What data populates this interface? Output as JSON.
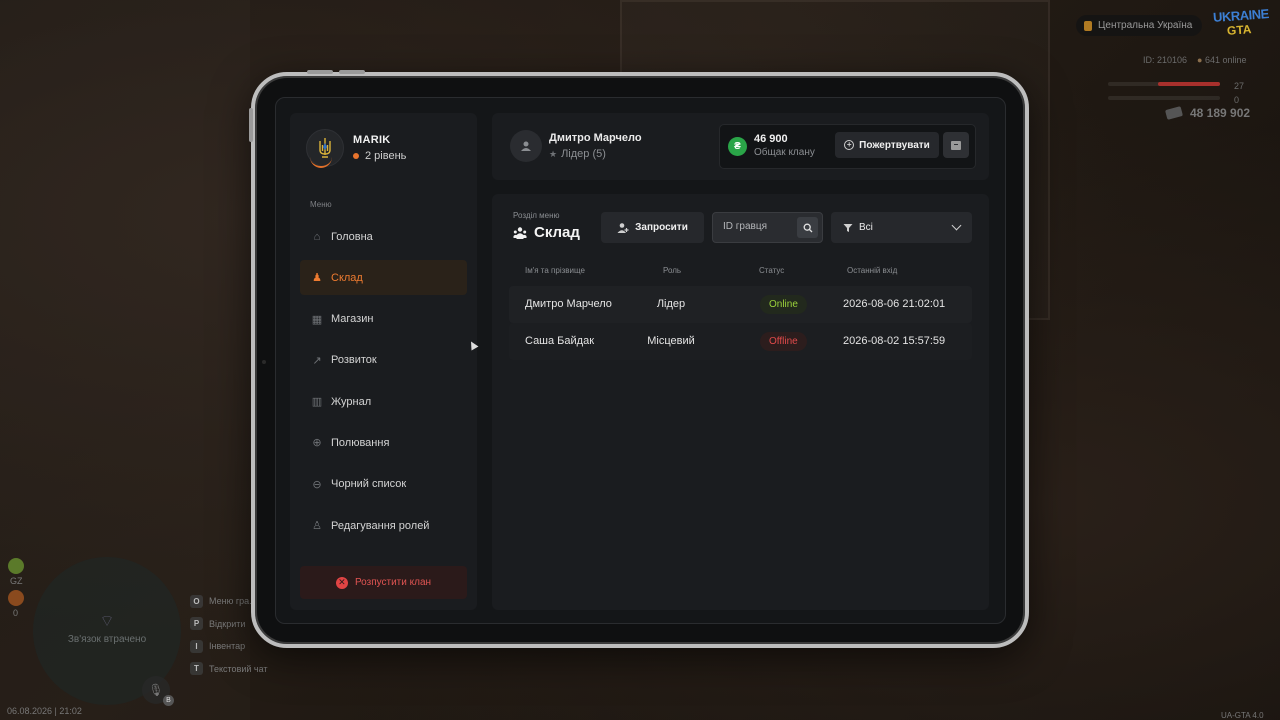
{
  "hud": {
    "region": "Центральна Україна",
    "logo_line1": "UKRAINE",
    "logo_line2": "GTA",
    "player_id": "ID: 210106",
    "online": "641 online",
    "health": "27",
    "armor": "0",
    "health_level": 0.55,
    "armor_level": 0.0,
    "money": "48 189 902",
    "gz_label": "GZ",
    "zero_label": "0",
    "minimap_text": "Зв'язок втрачено",
    "mic_badge": "B",
    "keys": [
      {
        "key": "O",
        "label": "Меню гра..."
      },
      {
        "key": "P",
        "label": "Відкрити"
      },
      {
        "key": "I",
        "label": "Інвентар"
      },
      {
        "key": "T",
        "label": "Текстовий чат"
      }
    ],
    "datetime": "06.08.2026 | 21:02",
    "version": "UA-GTA 4.0"
  },
  "sidebar": {
    "user_name": "MARIK",
    "level": "2 рівень",
    "menu_label": "Меню",
    "items": [
      {
        "label": "Головна",
        "icon": "home-icon",
        "glyph": "⌂",
        "active": false
      },
      {
        "label": "Склад",
        "icon": "members-icon",
        "glyph": "♟",
        "active": true
      },
      {
        "label": "Магазин",
        "icon": "shop-icon",
        "glyph": "▦",
        "active": false
      },
      {
        "label": "Розвиток",
        "icon": "chart-icon",
        "glyph": "↗",
        "active": false
      },
      {
        "label": "Журнал",
        "icon": "book-icon",
        "glyph": "▥",
        "active": false
      },
      {
        "label": "Полювання",
        "icon": "crosshair-icon",
        "glyph": "⊕",
        "active": false
      },
      {
        "label": "Чорний список",
        "icon": "blocked-icon",
        "glyph": "⊖",
        "active": false
      },
      {
        "label": "Редагування ролей",
        "icon": "user-edit-icon",
        "glyph": "♙",
        "active": false
      }
    ],
    "dissolve_label": "Розпустити клан"
  },
  "header": {
    "leader_name": "Дмитро Марчело",
    "leader_role": "Лідер (5)",
    "treasury_amount": "46 900",
    "treasury_label": "Общак клану",
    "donate_label": "Пожертвувати",
    "coin_symbol": "₴"
  },
  "main": {
    "section_label": "Розділ меню",
    "section_title": "Склад",
    "invite_label": "Запросити",
    "search_placeholder": "ID гравця",
    "filter_value": "Всі",
    "columns": [
      "Ім'я та прізвище",
      "Роль",
      "Статус",
      "Останній вхід"
    ],
    "rows": [
      {
        "name": "Дмитро Марчело",
        "role": "Лідер",
        "status": "Online",
        "last": "2026-08-06 21:02:01"
      },
      {
        "name": "Саша Байдак",
        "role": "Місцевий",
        "status": "Offline",
        "last": "2026-08-02 15:57:59"
      }
    ]
  },
  "colors": {
    "accent": "#ee7b30",
    "online": "#9bd23b",
    "offline": "#e04a4a",
    "coin": "#2aa548"
  }
}
